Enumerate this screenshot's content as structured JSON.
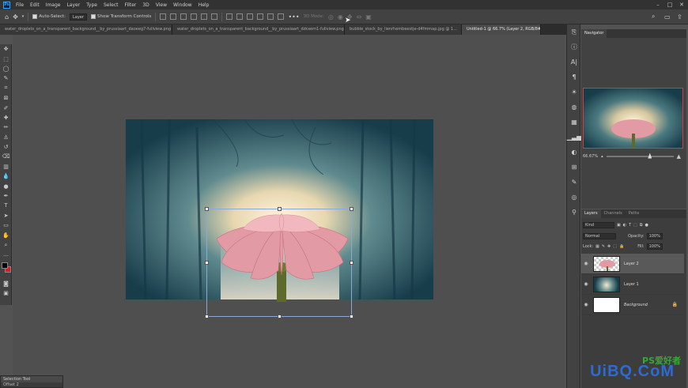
{
  "app": {
    "logo": "Ps"
  },
  "menu": [
    "File",
    "Edit",
    "Image",
    "Layer",
    "Type",
    "Select",
    "Filter",
    "3D",
    "View",
    "Window",
    "Help"
  ],
  "window_controls": {
    "minimize": "–",
    "maximize": "□",
    "close": "✕"
  },
  "options_bar": {
    "auto_select_label": "Auto-Select:",
    "auto_select_target": "Layer",
    "show_transform_label": "Show Transform Controls",
    "mode_label": "3D Mode:"
  },
  "tabs": [
    {
      "label": "water_droplets_on_a_transparent_background__by_prussiaart_daoeeg7-fullview.png",
      "active": false
    },
    {
      "label": "water_droplets_on_a_transparent_background__by_prussiaart_dzkxem1-fullview.png",
      "active": false
    },
    {
      "label": "bubble_stock_by_lienrhembeestje-d4fmmap.jpg @ 1...",
      "active": false
    },
    {
      "label": "Untitled-1 @ 66.7% (Layer 2, RGB/8#) *",
      "active": true
    }
  ],
  "panels": {
    "navigator": {
      "title": "Navigator",
      "zoom": "66.67%",
      "zoom_slider_value": 0.62
    },
    "layers": {
      "tabs": [
        "Layers",
        "Channels",
        "Paths"
      ],
      "kind_label": "Kind",
      "blend_mode": "Normal",
      "opacity_label": "Opacity:",
      "opacity_value": "100%",
      "lock_label": "Lock:",
      "fill_label": "Fill:",
      "fill_value": "100%",
      "items": [
        {
          "name": "Layer 2",
          "selected": true,
          "thumb": "flower"
        },
        {
          "name": "Layer 1",
          "selected": false,
          "thumb": "forest"
        },
        {
          "name": "Background",
          "selected": false,
          "thumb": "white",
          "locked": true
        }
      ]
    }
  },
  "floating_panel": {
    "title": "Selection Tool",
    "subtitle": "Offset 2"
  },
  "colors": {
    "foreground": "#000000",
    "background": "#d42020",
    "selection_box": "#8aa8d8"
  },
  "watermark": {
    "text": "UiBQ.CoM",
    "sub": "PS爱好者"
  }
}
